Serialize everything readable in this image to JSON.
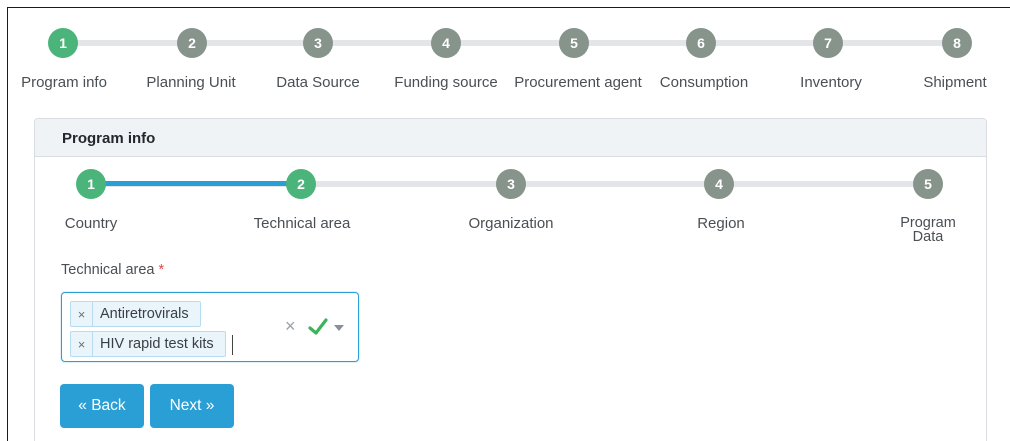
{
  "top_steps": [
    {
      "num": "1",
      "label": "Program info",
      "state": "active"
    },
    {
      "num": "2",
      "label": "Planning Unit",
      "state": "todo"
    },
    {
      "num": "3",
      "label": "Data Source",
      "state": "todo"
    },
    {
      "num": "4",
      "label": "Funding source",
      "state": "todo"
    },
    {
      "num": "5",
      "label": "Procurement agent",
      "state": "todo"
    },
    {
      "num": "6",
      "label": "Consumption",
      "state": "todo"
    },
    {
      "num": "7",
      "label": "Inventory",
      "state": "todo"
    },
    {
      "num": "8",
      "label": "Shipment",
      "state": "todo"
    }
  ],
  "card": {
    "title": "Program info"
  },
  "sub_steps": [
    {
      "num": "1",
      "label": "Country",
      "state": "done"
    },
    {
      "num": "2",
      "label": "Technical area",
      "state": "active"
    },
    {
      "num": "3",
      "label": "Organization",
      "state": "todo"
    },
    {
      "num": "4",
      "label": "Region",
      "state": "todo"
    },
    {
      "num": "5",
      "label": "Program Data",
      "state": "todo"
    }
  ],
  "field": {
    "label": "Technical area",
    "required_mark": "*",
    "selected": [
      "Antiretrovirals",
      "HIV rapid test kits"
    ],
    "chip_remove": "×",
    "clear_icon": "×"
  },
  "buttons": {
    "back": "« Back",
    "next": "Next »"
  },
  "colors": {
    "accent": "#2a9fd6",
    "step_active": "#4ab47a",
    "step_inactive": "#86948c",
    "valid_check": "#3cb35b",
    "required": "#e64646"
  }
}
